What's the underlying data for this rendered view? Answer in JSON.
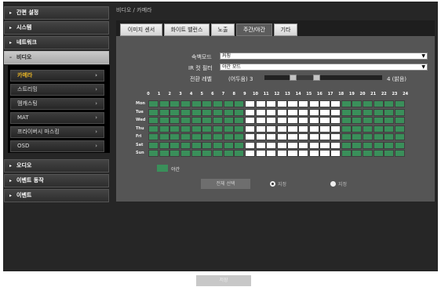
{
  "breadcrumb": "비디오 / 카메라",
  "sidebar": {
    "items": [
      {
        "label": "간편 설정",
        "expanded": false
      },
      {
        "label": "시스템",
        "expanded": false
      },
      {
        "label": "네트워크",
        "expanded": false
      },
      {
        "label": "비디오",
        "expanded": true
      },
      {
        "label": "오디오",
        "expanded": false
      },
      {
        "label": "이벤트 동작",
        "expanded": false
      },
      {
        "label": "이벤트",
        "expanded": false
      }
    ],
    "sub_items": [
      {
        "label": "카메라",
        "active": true
      },
      {
        "label": "스트리밍",
        "active": false
      },
      {
        "label": "멤캐스팅",
        "active": false
      },
      {
        "label": "MAT",
        "active": false
      },
      {
        "label": "프라이버시 마스킹",
        "active": false
      },
      {
        "label": "OSD",
        "active": false
      }
    ]
  },
  "tabs": [
    {
      "label": "이미지 센서",
      "active": false
    },
    {
      "label": "화이트 밸런스",
      "active": false
    },
    {
      "label": "노출",
      "active": false
    },
    {
      "label": "주간/야간",
      "active": true
    },
    {
      "label": "기타",
      "active": false
    }
  ],
  "form": {
    "color_mode_label": "속백모드",
    "color_mode_value": "커칭",
    "ir_filter_label": "IR 컷 필터",
    "ir_filter_value": "야간 모드",
    "transition_label": "전환 레벨",
    "transition_min": "(어두움) 3",
    "transition_max": "4 (밝음)",
    "transition_range_fraction": [
      0.24,
      0.44
    ]
  },
  "schedule": {
    "hours": [
      "0",
      "1",
      "2",
      "3",
      "4",
      "5",
      "6",
      "7",
      "8",
      "9",
      "10",
      "11",
      "12",
      "13",
      "14",
      "15",
      "16",
      "17",
      "18",
      "19",
      "20",
      "21",
      "22",
      "23",
      "24"
    ],
    "days": [
      "Mon",
      "Tue",
      "Wed",
      "Thu",
      "Fri",
      "Sat",
      "Sun"
    ],
    "night_hours": [
      0,
      1,
      2,
      3,
      4,
      5,
      6,
      7,
      8,
      18,
      19,
      20,
      21,
      22,
      23
    ],
    "legend_label": "야간",
    "select_all_label": "전체 선택",
    "radio_set_label": "지정",
    "radio_clear_label": "지정",
    "night_color": "#3a8f5a",
    "day_color": "#ffffff"
  },
  "save_label": "저장"
}
